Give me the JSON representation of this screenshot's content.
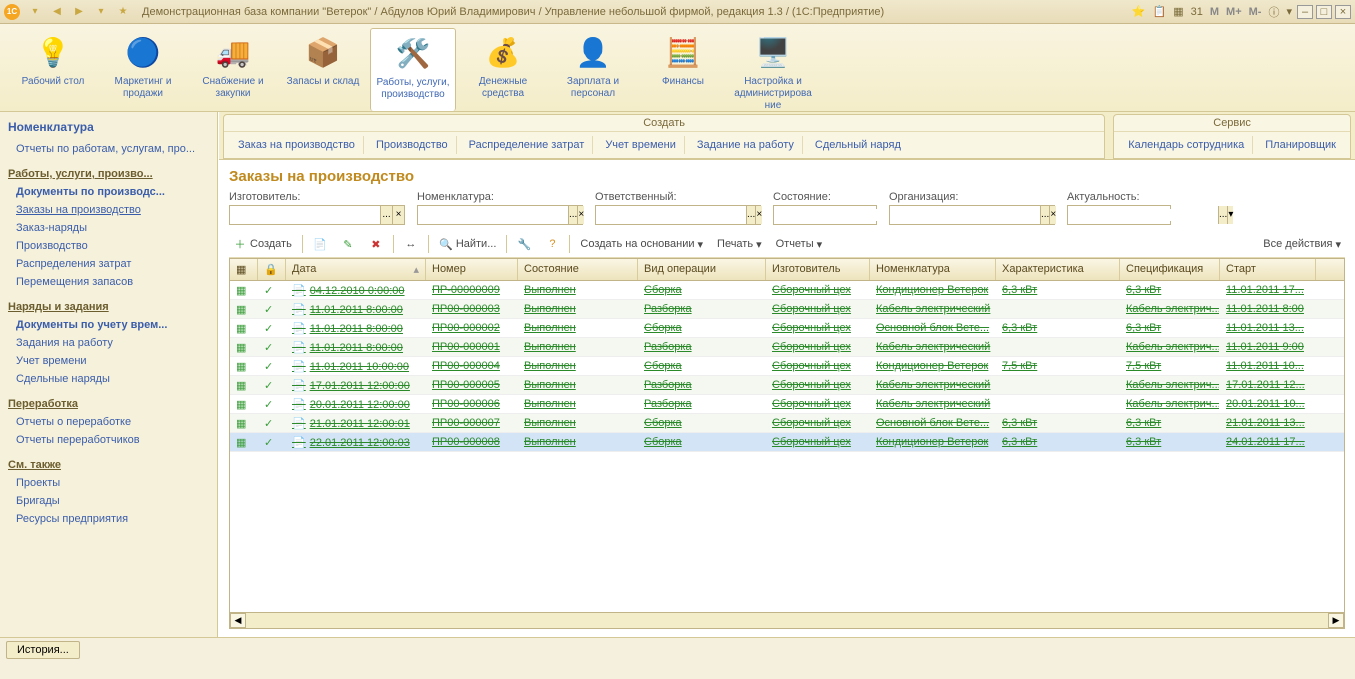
{
  "title": "Демонстрационная база компании \"Ветерок\" / Абдулов Юрий Владимирович / Управление небольшой фирмой, редакция 1.3 / (1С:Предприятие)",
  "main_nav": [
    {
      "label": "Рабочий стол",
      "icon": "💡"
    },
    {
      "label": "Маркетинг и продажи",
      "icon": "🔵"
    },
    {
      "label": "Снабжение и закупки",
      "icon": "🚚"
    },
    {
      "label": "Запасы и склад",
      "icon": "📦"
    },
    {
      "label": "Работы, услуги, производство",
      "icon": "🛠️",
      "active": true
    },
    {
      "label": "Денежные средства",
      "icon": "💰"
    },
    {
      "label": "Зарплата и персонал",
      "icon": "👤"
    },
    {
      "label": "Финансы",
      "icon": "🧮"
    },
    {
      "label": "Настройка и администрирование",
      "icon": "🖥️"
    }
  ],
  "sec_groups": [
    {
      "title": "Создать",
      "items": [
        "Заказ на производство",
        "Производство",
        "Распределение затрат",
        "Учет времени",
        "Задание на работу",
        "Сдельный наряд"
      ]
    },
    {
      "title": "Сервис",
      "items": [
        "Календарь сотрудника",
        "Планировщик"
      ]
    }
  ],
  "sidebar": {
    "panel_title": "Номенклатура",
    "reports": "Отчеты по работам, услугам, про...",
    "groups": [
      {
        "title": "Работы, услуги, произво...",
        "items": [
          {
            "label": "Документы по производс...",
            "bold": true
          },
          {
            "label": "Заказы на производство",
            "bold": false,
            "underline": true
          },
          {
            "label": "Заказ-наряды"
          },
          {
            "label": "Производство"
          },
          {
            "label": "Распределения затрат"
          },
          {
            "label": "Перемещения запасов"
          }
        ]
      },
      {
        "title": "Наряды и задания",
        "items": [
          {
            "label": "Документы по учету врем...",
            "bold": true
          },
          {
            "label": "Задания на работу"
          },
          {
            "label": "Учет времени"
          },
          {
            "label": "Сдельные наряды"
          }
        ]
      },
      {
        "title": "Переработка",
        "items": [
          {
            "label": "Отчеты о переработке"
          },
          {
            "label": "Отчеты переработчиков"
          }
        ]
      },
      {
        "title": "См. также",
        "items": [
          {
            "label": "Проекты"
          },
          {
            "label": "Бригады"
          },
          {
            "label": "Ресурсы предприятия"
          }
        ]
      }
    ]
  },
  "content": {
    "heading": "Заказы на производство",
    "filters": [
      {
        "label": "Изготовитель:",
        "w": 176
      },
      {
        "label": "Номенклатура:",
        "w": 166
      },
      {
        "label": "Ответственный:",
        "w": 166
      },
      {
        "label": "Состояние:",
        "w": 104
      },
      {
        "label": "Организация:",
        "w": 166
      },
      {
        "label": "Актуальность:",
        "w": 104,
        "noclear": true
      }
    ],
    "actions": {
      "create": "Создать",
      "find": "Найти...",
      "create_based": "Создать на основании",
      "print": "Печать",
      "reports": "Отчеты",
      "all_actions": "Все действия"
    },
    "columns": [
      "",
      "",
      "Дата",
      "Номер",
      "Состояние",
      "Вид операции",
      "Изготовитель",
      "Номенклатура",
      "Характеристика",
      "Спецификация",
      "Старт"
    ],
    "rows": [
      {
        "date": "04.12.2010 0:00:00",
        "num": "ПР-00000009",
        "state": "Выполнен",
        "op": "Сборка",
        "mfg": "Сборочный цех",
        "nom": "Кондиционер Ветерок",
        "char": "6,3 кВт",
        "spec": "6,3 кВт",
        "start": "11.01.2011 17..."
      },
      {
        "date": "11.01.2011 8:00:00",
        "num": "ПР00-000003",
        "state": "Выполнен",
        "op": "Разборка",
        "mfg": "Сборочный цех",
        "nom": "Кабель электрический",
        "char": "",
        "spec": "Кабель электрич...",
        "start": "11.01.2011 8:00"
      },
      {
        "date": "11.01.2011 8:00:00",
        "num": "ПР00-000002",
        "state": "Выполнен",
        "op": "Сборка",
        "mfg": "Сборочный цех",
        "nom": "Основной блок Вете...",
        "char": "6,3 кВт",
        "spec": "6,3 кВт",
        "start": "11.01.2011 13..."
      },
      {
        "date": "11.01.2011 8:00:00",
        "num": "ПР00-000001",
        "state": "Выполнен",
        "op": "Разборка",
        "mfg": "Сборочный цех",
        "nom": "Кабель электрический",
        "char": "",
        "spec": "Кабель электрич...",
        "start": "11.01.2011 9:00"
      },
      {
        "date": "11.01.2011 10:00:00",
        "num": "ПР00-000004",
        "state": "Выполнен",
        "op": "Сборка",
        "mfg": "Сборочный цех",
        "nom": "Кондиционер Ветерок",
        "char": "7,5 кВт",
        "spec": "7,5 кВт",
        "start": "11.01.2011 10..."
      },
      {
        "date": "17.01.2011 12:00:00",
        "num": "ПР00-000005",
        "state": "Выполнен",
        "op": "Разборка",
        "mfg": "Сборочный цех",
        "nom": "Кабель электрический",
        "char": "",
        "spec": "Кабель электрич...",
        "start": "17.01.2011 12..."
      },
      {
        "date": "20.01.2011 12:00:00",
        "num": "ПР00-000006",
        "state": "Выполнен",
        "op": "Разборка",
        "mfg": "Сборочный цех",
        "nom": "Кабель электрический",
        "char": "",
        "spec": "Кабель электрич...",
        "start": "20.01.2011 10..."
      },
      {
        "date": "21.01.2011 12:00:01",
        "num": "ПР00-000007",
        "state": "Выполнен",
        "op": "Сборка",
        "mfg": "Сборочный цех",
        "nom": "Основной блок Вете...",
        "char": "6,3 кВт",
        "spec": "6,3 кВт",
        "start": "21.01.2011 13..."
      },
      {
        "date": "22.01.2011 12:00:03",
        "num": "ПР00-000008",
        "state": "Выполнен",
        "op": "Сборка",
        "mfg": "Сборочный цех",
        "nom": "Кондиционер Ветерок",
        "char": "6,3 кВт",
        "spec": "6,3 кВт",
        "start": "24.01.2011 17...",
        "selected": true
      }
    ]
  },
  "history_btn": "История..."
}
